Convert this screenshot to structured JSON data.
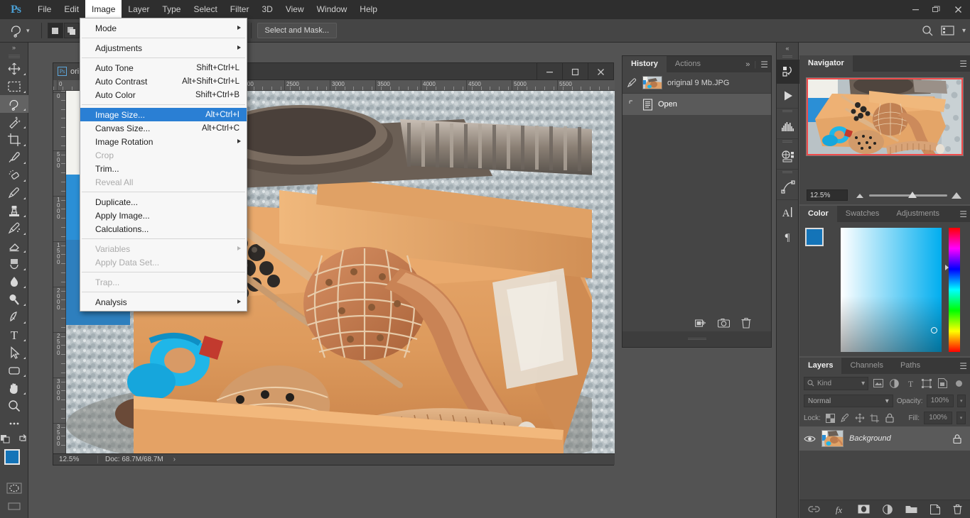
{
  "app": {
    "name": "Adobe Photoshop",
    "logo_text": "Ps"
  },
  "menubar": {
    "items": [
      {
        "label": "File",
        "active": false
      },
      {
        "label": "Edit",
        "active": false
      },
      {
        "label": "Image",
        "active": true
      },
      {
        "label": "Layer",
        "active": false
      },
      {
        "label": "Type",
        "active": false
      },
      {
        "label": "Select",
        "active": false
      },
      {
        "label": "Filter",
        "active": false
      },
      {
        "label": "3D",
        "active": false
      },
      {
        "label": "View",
        "active": false
      },
      {
        "label": "Window",
        "active": false
      },
      {
        "label": "Help",
        "active": false
      }
    ],
    "window_controls": {
      "minimize": "—",
      "restore": "❐",
      "close": "✕"
    }
  },
  "image_menu": {
    "items": [
      {
        "label": "Mode",
        "shortcut": "",
        "submenu": true,
        "disabled": false,
        "highlighted": false
      },
      {
        "separator": true
      },
      {
        "label": "Adjustments",
        "shortcut": "",
        "submenu": true,
        "disabled": false,
        "highlighted": false
      },
      {
        "separator": true
      },
      {
        "label": "Auto Tone",
        "shortcut": "Shift+Ctrl+L",
        "submenu": false,
        "disabled": false,
        "highlighted": false
      },
      {
        "label": "Auto Contrast",
        "shortcut": "Alt+Shift+Ctrl+L",
        "submenu": false,
        "disabled": false,
        "highlighted": false
      },
      {
        "label": "Auto Color",
        "shortcut": "Shift+Ctrl+B",
        "submenu": false,
        "disabled": false,
        "highlighted": false
      },
      {
        "separator": true
      },
      {
        "label": "Image Size...",
        "shortcut": "Alt+Ctrl+I",
        "submenu": false,
        "disabled": false,
        "highlighted": true
      },
      {
        "label": "Canvas Size...",
        "shortcut": "Alt+Ctrl+C",
        "submenu": false,
        "disabled": false,
        "highlighted": false
      },
      {
        "label": "Image Rotation",
        "shortcut": "",
        "submenu": true,
        "disabled": false,
        "highlighted": false
      },
      {
        "label": "Crop",
        "shortcut": "",
        "submenu": false,
        "disabled": true,
        "highlighted": false
      },
      {
        "label": "Trim...",
        "shortcut": "",
        "submenu": false,
        "disabled": false,
        "highlighted": false
      },
      {
        "label": "Reveal All",
        "shortcut": "",
        "submenu": false,
        "disabled": true,
        "highlighted": false
      },
      {
        "separator": true
      },
      {
        "label": "Duplicate...",
        "shortcut": "",
        "submenu": false,
        "disabled": false,
        "highlighted": false
      },
      {
        "label": "Apply Image...",
        "shortcut": "",
        "submenu": false,
        "disabled": false,
        "highlighted": false
      },
      {
        "label": "Calculations...",
        "shortcut": "",
        "submenu": false,
        "disabled": false,
        "highlighted": false
      },
      {
        "separator": true
      },
      {
        "label": "Variables",
        "shortcut": "",
        "submenu": true,
        "disabled": true,
        "highlighted": false
      },
      {
        "label": "Apply Data Set...",
        "shortcut": "",
        "submenu": false,
        "disabled": true,
        "highlighted": false
      },
      {
        "separator": true
      },
      {
        "label": "Trap...",
        "shortcut": "",
        "submenu": false,
        "disabled": true,
        "highlighted": false
      },
      {
        "separator": true
      },
      {
        "label": "Analysis",
        "shortcut": "",
        "submenu": true,
        "disabled": false,
        "highlighted": false
      }
    ],
    "highlight_color": "#2a7fd4"
  },
  "options_bar": {
    "active_tool_icon": "lasso-tool-icon",
    "selection_modes": [
      "new-selection-icon",
      "add-to-selection-icon",
      "subtract-from-selection-icon",
      "intersect-selection-icon"
    ],
    "select_and_mask_label": "Select and Mask...",
    "right_icons": [
      "search-icon",
      "workspace-switcher-icon",
      "chevron-down-icon"
    ]
  },
  "toolbar": {
    "collapse_label": "»",
    "tools": [
      {
        "name": "move-tool",
        "selected": false
      },
      {
        "name": "rectangular-marquee-tool",
        "selected": false
      },
      {
        "name": "lasso-tool",
        "selected": true
      },
      {
        "name": "quick-selection-tool",
        "selected": false
      },
      {
        "name": "crop-tool",
        "selected": false
      },
      {
        "name": "eyedropper-tool",
        "selected": false
      },
      {
        "name": "spot-healing-brush-tool",
        "selected": false
      },
      {
        "name": "brush-tool",
        "selected": false
      },
      {
        "name": "clone-stamp-tool",
        "selected": false
      },
      {
        "name": "history-brush-tool",
        "selected": false
      },
      {
        "name": "eraser-tool",
        "selected": false
      },
      {
        "name": "gradient-tool",
        "selected": false
      },
      {
        "name": "blur-tool",
        "selected": false
      },
      {
        "name": "dodge-tool",
        "selected": false
      },
      {
        "name": "pen-tool",
        "selected": false
      },
      {
        "name": "horizontal-type-tool",
        "selected": false
      },
      {
        "name": "path-selection-tool",
        "selected": false
      },
      {
        "name": "rectangle-tool",
        "selected": false
      },
      {
        "name": "hand-tool",
        "selected": false
      },
      {
        "name": "zoom-tool",
        "selected": false
      },
      {
        "name": "edit-toolbar-tool",
        "selected": false
      }
    ],
    "foreground_color": "#1474b8",
    "background_color": "#000000"
  },
  "document": {
    "tab_title": "original 9 Mb.JPG",
    "tab_title_visible": "ori",
    "window_controls": {
      "minimize": "—",
      "restore": "□",
      "close": "✕"
    },
    "ruler_horizontal_labels": [
      "0",
      "2000",
      "2500",
      "3000",
      "3500",
      "4000",
      "4500",
      "5000",
      "5500"
    ],
    "ruler_vertical_labels": [
      "0",
      "500",
      "1000",
      "1500",
      "2000",
      "2500",
      "3000",
      "3500"
    ],
    "status": {
      "zoom": "12.5%",
      "doc_size": "Doc: 68.7M/68.7M",
      "arrow": "›"
    }
  },
  "rail": {
    "collapse_label": "«",
    "buttons": [
      {
        "name": "history-actions-icon",
        "selected": true
      },
      {
        "name": "play-actions-icon",
        "selected": false
      },
      {
        "name": "histogram-icon",
        "selected": false
      },
      {
        "name": "properties-3d-icon",
        "selected": false
      },
      {
        "name": "paths-icon",
        "selected": false
      },
      {
        "name": "character-panel-icon",
        "selected": false
      },
      {
        "name": "paragraph-panel-icon",
        "selected": false
      }
    ]
  },
  "history_panel": {
    "tabs": [
      {
        "label": "History",
        "active": true
      },
      {
        "label": "Actions",
        "active": false
      }
    ],
    "collapse_icon": "»",
    "menu_icon": "☰",
    "snapshot": {
      "label": "original 9 Mb.JPG",
      "icon": "snapshot-brush-icon"
    },
    "states": [
      {
        "label": "Open",
        "icon": "open-document-icon",
        "selected": true
      }
    ],
    "footer_icons": [
      "new-document-from-state-icon",
      "new-snapshot-icon",
      "delete-state-icon"
    ]
  },
  "navigator_panel": {
    "tabs": [
      {
        "label": "Navigator",
        "active": true
      }
    ],
    "menu_icon": "☰",
    "zoom_value": "12.5%",
    "view_box_color": "#ef4a4a",
    "zoom_out_icon": "zoom-out-icon",
    "zoom_in_icon": "zoom-in-icon"
  },
  "color_panel": {
    "tabs": [
      {
        "label": "Color",
        "active": true
      },
      {
        "label": "Swatches",
        "active": false
      },
      {
        "label": "Adjustments",
        "active": false
      }
    ],
    "menu_icon": "☰",
    "foreground_color": "#1474b8",
    "background_color": "#000000"
  },
  "layers_panel": {
    "tabs": [
      {
        "label": "Layers",
        "active": true
      },
      {
        "label": "Channels",
        "active": false
      },
      {
        "label": "Paths",
        "active": false
      }
    ],
    "menu_icon": "☰",
    "filter": {
      "kind_label": "Kind",
      "search_icon": "search-icon",
      "chevron": "⌄",
      "filter_icons": [
        "filter-image-icon",
        "filter-adjustment-icon",
        "filter-type-icon",
        "filter-shape-icon",
        "filter-smart-object-icon"
      ],
      "toggle_icon": "filter-toggle-icon"
    },
    "blend_mode": "Normal",
    "opacity_label": "Opacity:",
    "opacity_value": "100%",
    "lock_label": "Lock:",
    "lock_icons": [
      "lock-transparent-pixels-icon",
      "lock-image-pixels-icon",
      "lock-position-icon",
      "lock-artboard-icon",
      "lock-all-icon"
    ],
    "fill_label": "Fill:",
    "fill_value": "100%",
    "layers": [
      {
        "name": "Background",
        "visible": true,
        "locked": true,
        "selected": true
      }
    ],
    "footer_icons": [
      "link-layers-icon",
      "layer-style-fx-icon",
      "add-layer-mask-icon",
      "new-adjustment-layer-icon",
      "new-group-icon",
      "new-layer-icon",
      "delete-layer-icon"
    ]
  }
}
